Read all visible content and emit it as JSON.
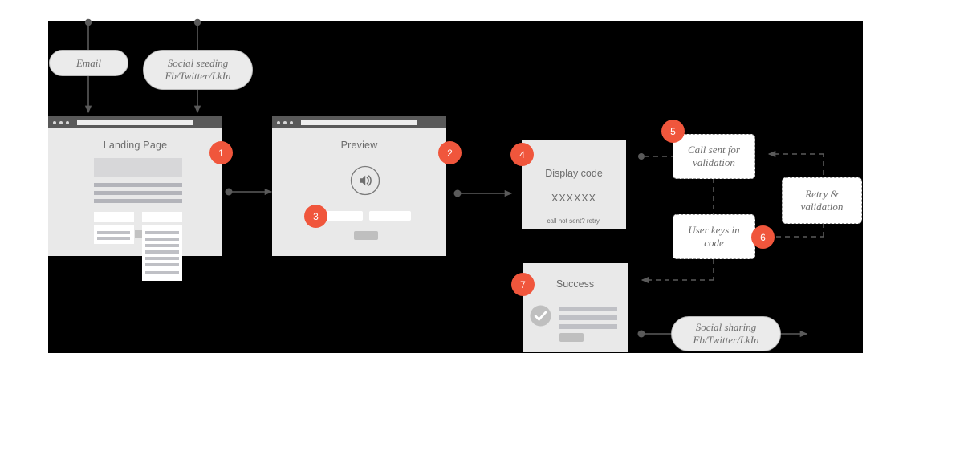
{
  "diagram": {
    "title": "User flow diagram",
    "accent_color": "#f0563c",
    "stage_bg": "#000000"
  },
  "sources": [
    {
      "id": "email",
      "label": "Email"
    },
    {
      "id": "social-seeding",
      "line1": "Social seeding",
      "line2": "Fb/Twitter/LkIn"
    }
  ],
  "screens": {
    "landing": {
      "title": "Landing Page",
      "badge": "1"
    },
    "preview": {
      "title": "Preview",
      "badge": "2",
      "form_badge": "3",
      "icon": "speaker-icon"
    },
    "display_code": {
      "title": "Display code",
      "code": "XXXXXX",
      "note": "call not sent? retry.",
      "badge": "4"
    },
    "success": {
      "title": "Success",
      "badge": "7",
      "icon": "check-circle-icon"
    }
  },
  "process_boxes": [
    {
      "id": "call-sent",
      "line1": "Call sent for",
      "line2": "validation",
      "badge": "5"
    },
    {
      "id": "user-keys-in-code",
      "line1": "User keys in",
      "line2": "code",
      "badge": "6"
    },
    {
      "id": "retry-validation",
      "line1": "Retry &",
      "line2": "validation"
    }
  ],
  "outcome": {
    "id": "social-sharing",
    "line1": "Social sharing",
    "line2": "Fb/Twitter/LkIn"
  }
}
